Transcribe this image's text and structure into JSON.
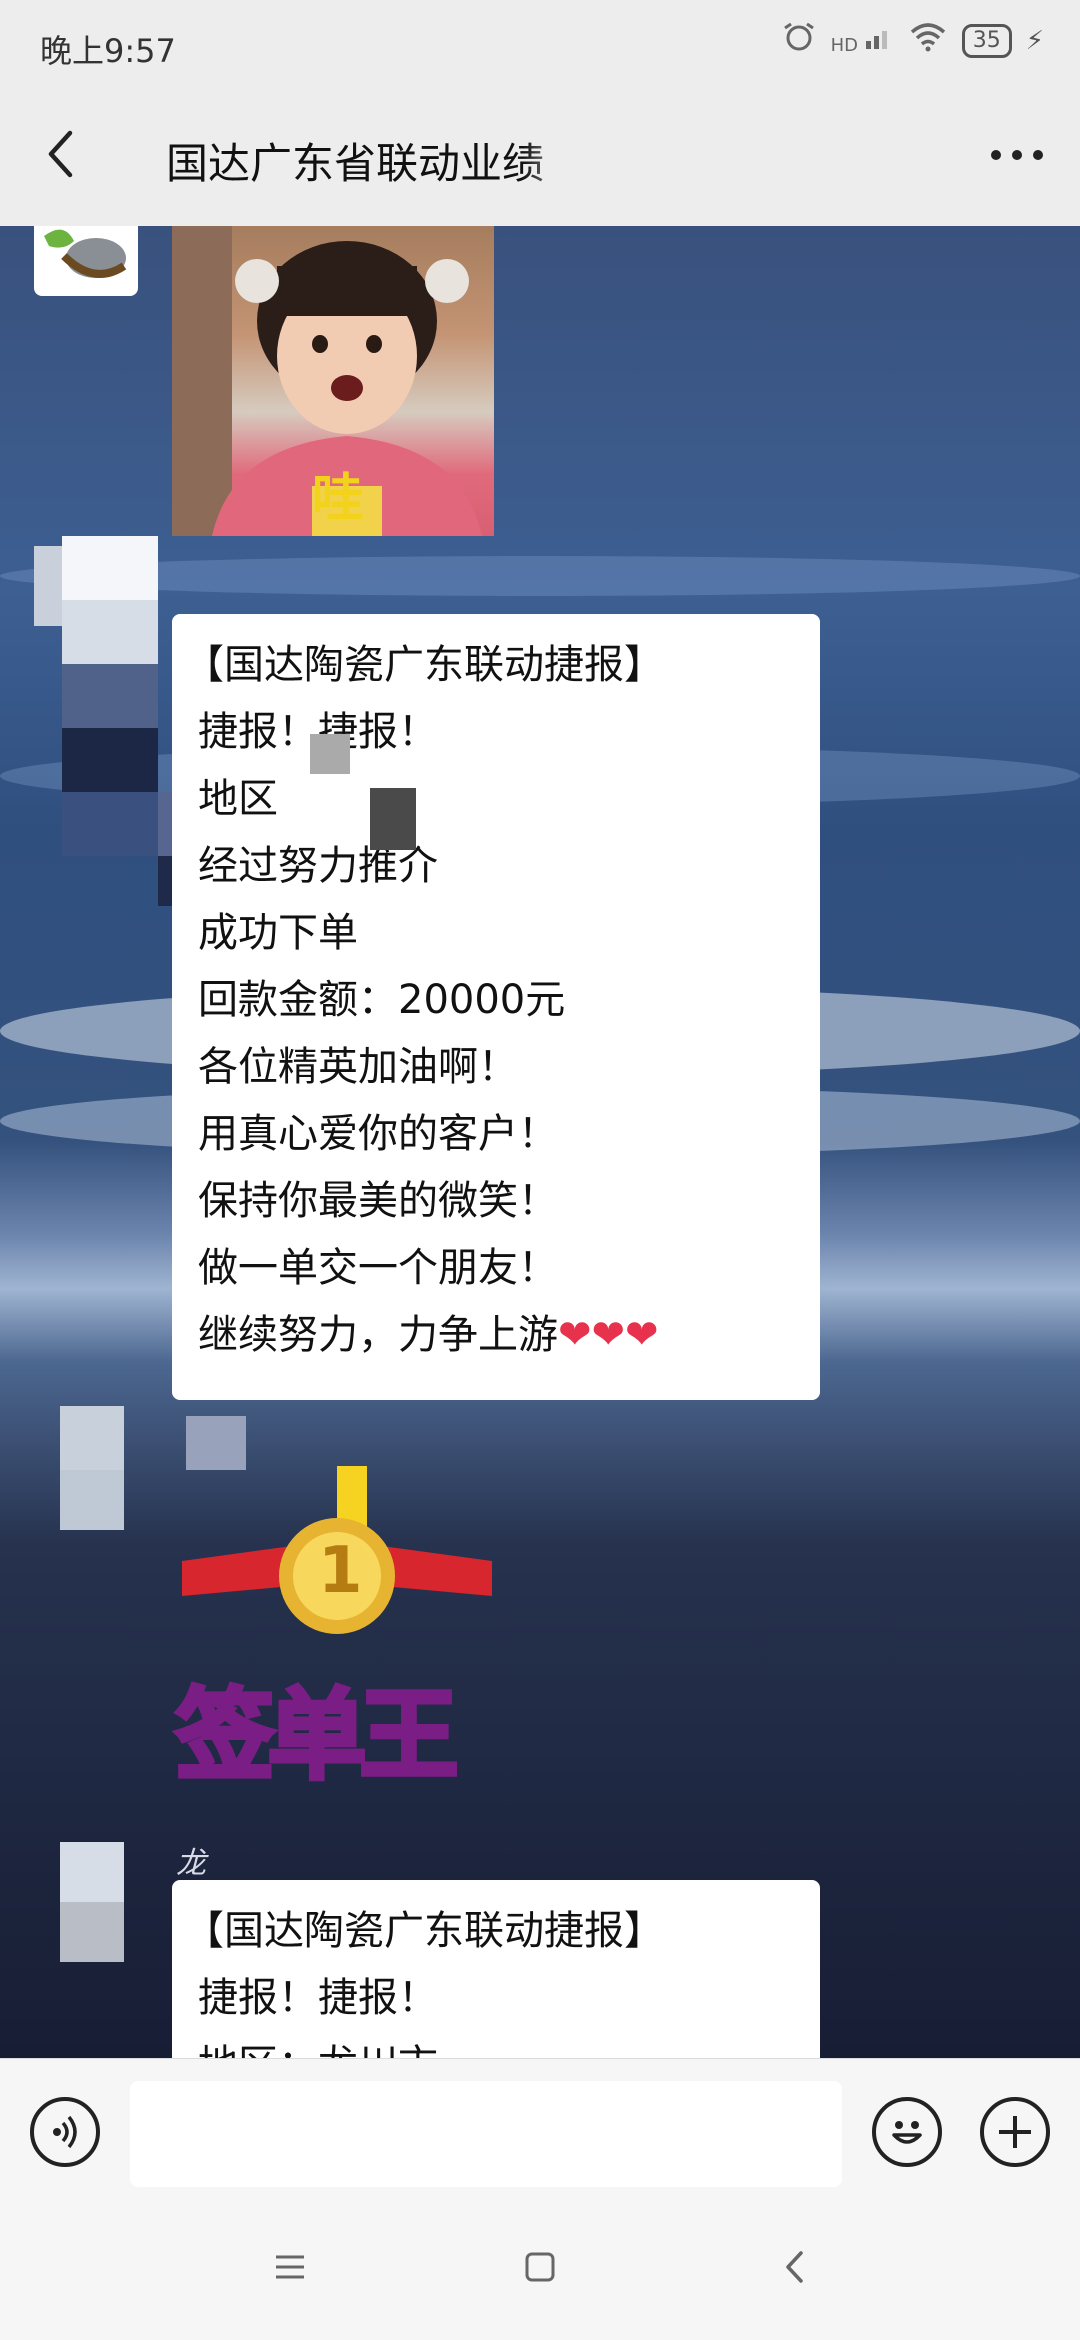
{
  "status_bar": {
    "time": "晚上9:57",
    "network": "HD",
    "battery": "35"
  },
  "title_bar": {
    "title": "国达广东省联动业绩"
  },
  "messages": {
    "report1": {
      "lines": [
        "【国达陶瓷广东联动捷报】",
        "捷报！捷报！",
        "地区",
        "经过努力推介",
        "成功下单",
        "回款金额：20000元",
        "各位精英加油啊！",
        "用真心爱你的客户！",
        "保持你最美的微笑！",
        "做一单交一个朋友！",
        "继续努力，力争上游"
      ],
      "hearts": "❤❤❤"
    },
    "sticker1": {
      "text": "哇"
    },
    "sticker2": {
      "text": "签单王",
      "medal": "1"
    },
    "sender2": "龙",
    "report2": {
      "lines": [
        "【国达陶瓷广东联动捷报】",
        "捷报！捷报！",
        "地区：龙川市"
      ]
    }
  },
  "input_bar": {
    "placeholder": ""
  },
  "icons": {
    "back": "back-arrow-icon",
    "more": "more-dots-icon",
    "voice": "voice-icon",
    "emoji": "emoji-icon",
    "plus": "plus-icon",
    "nav_menu": "menu-icon",
    "nav_home": "home-icon",
    "nav_back": "nav-back-icon"
  },
  "colors": {
    "bar_bg": "#ededed",
    "bubble_bg": "#ffffff",
    "heart": "#e8324d"
  }
}
